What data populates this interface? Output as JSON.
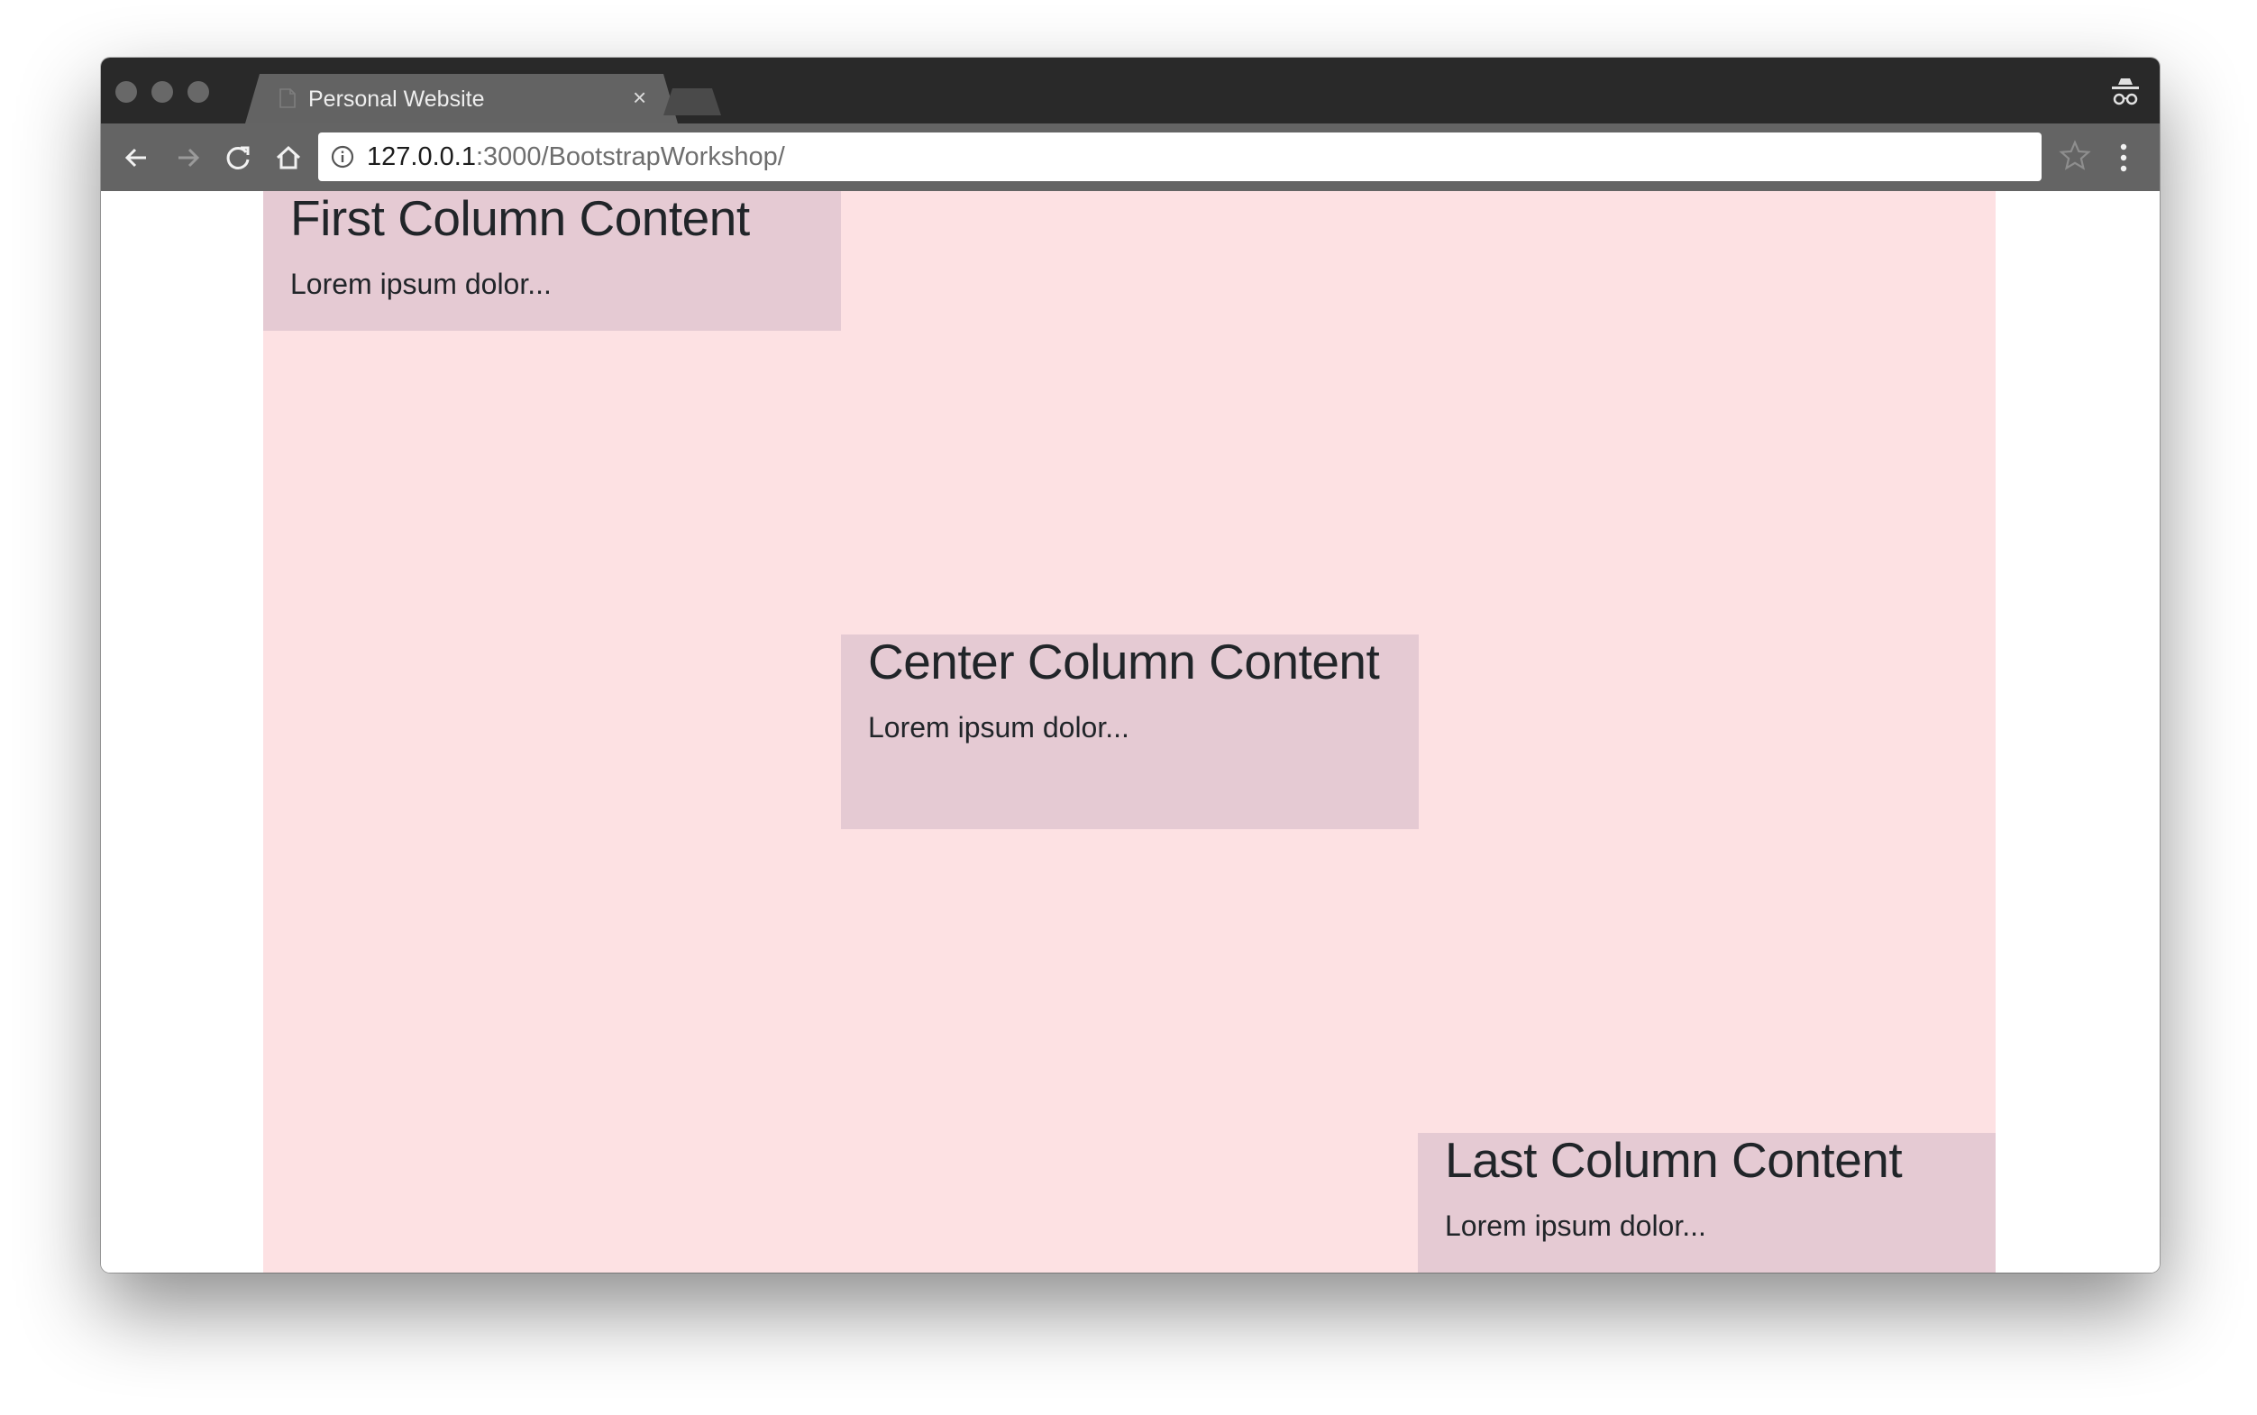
{
  "browser": {
    "tab_title": "Personal Website",
    "tab_close": "×",
    "url_host": "127.0.0.1",
    "url_rest": ":3000/BootstrapWorkshop/",
    "icons": {
      "tab_document": "document-icon",
      "close": "close-icon",
      "new_tab": "new-tab-icon",
      "incognito": "incognito-icon",
      "back": "back-arrow-icon",
      "forward": "forward-arrow-icon",
      "reload": "reload-icon",
      "home": "home-icon",
      "site_info": "info-icon",
      "bookmark": "star-icon",
      "menu": "kebab-menu-icon"
    }
  },
  "page": {
    "colors": {
      "container_bg": "#fde1e3",
      "column_bg": "#e5cad3",
      "text": "#212529"
    },
    "columns": [
      {
        "heading": "First Column Content",
        "text": "Lorem ipsum dolor..."
      },
      {
        "heading": "Center Column Content",
        "text": "Lorem ipsum dolor..."
      },
      {
        "heading": "Last Column Content",
        "text": "Lorem ipsum dolor..."
      }
    ]
  }
}
